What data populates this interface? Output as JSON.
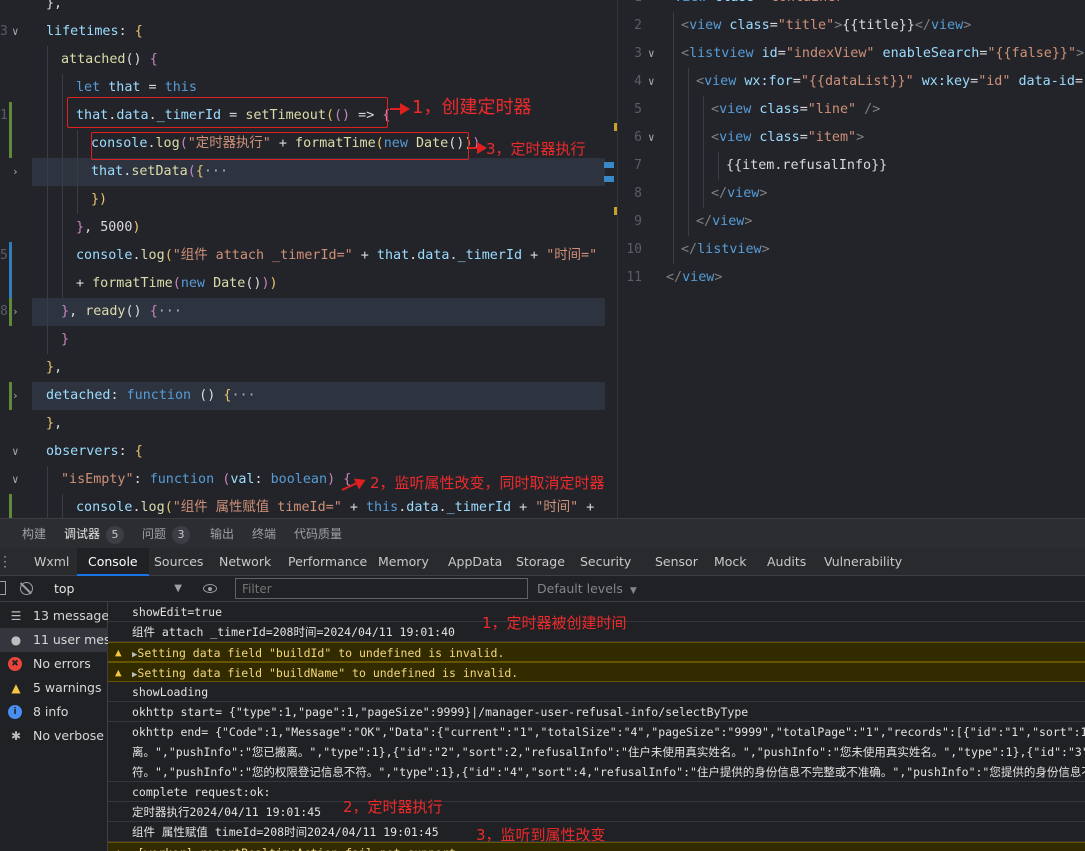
{
  "editor_left": {
    "lines": [
      {
        "num": "",
        "segs": [
          [
            "p",
            "},"
          ]
        ]
      },
      {
        "num": "3",
        "segs": [
          [
            "pr",
            "lifetimes"
          ],
          [
            "o",
            ": "
          ],
          [
            "y",
            "{"
          ]
        ]
      },
      {
        "num": "",
        "segs": [
          [
            "fn",
            "attached"
          ],
          [
            "p",
            "() "
          ],
          [
            "pk",
            "{"
          ]
        ]
      },
      {
        "num": "",
        "segs": [
          [
            "k",
            "let "
          ],
          [
            "pr",
            "that"
          ],
          [
            "o",
            " = "
          ],
          [
            "k",
            "this"
          ]
        ]
      },
      {
        "num": "1",
        "segs": [
          [
            "pr",
            "that"
          ],
          [
            "o",
            "."
          ],
          [
            "pr",
            "data"
          ],
          [
            "o",
            "."
          ],
          [
            "pr",
            "_timerId"
          ],
          [
            "o",
            " = "
          ],
          [
            "fn",
            "setTimeout"
          ],
          [
            "y",
            "("
          ],
          [
            "pk",
            "()"
          ],
          [
            "o",
            " => "
          ],
          [
            "pk",
            "{"
          ]
        ]
      },
      {
        "num": "",
        "segs": [
          [
            "pr",
            "console"
          ],
          [
            "o",
            "."
          ],
          [
            "fn",
            "log"
          ],
          [
            "pk",
            "("
          ],
          [
            "s",
            "\"定时器执行\""
          ],
          [
            "o",
            " + "
          ],
          [
            "fn",
            "formatTime"
          ],
          [
            "y",
            "("
          ],
          [
            "k",
            "new "
          ],
          [
            "fn",
            "Date"
          ],
          [
            "p",
            "()"
          ],
          [
            "y",
            ")"
          ],
          [
            "pk",
            ")"
          ]
        ]
      },
      {
        "num": "",
        "segs": [
          [
            "pr",
            "that"
          ],
          [
            "o",
            "."
          ],
          [
            "fn",
            "setData"
          ],
          [
            "pk",
            "("
          ],
          [
            "y",
            "{"
          ],
          [
            "g",
            "···"
          ]
        ]
      },
      {
        "num": "",
        "segs": [
          [
            "y",
            "})"
          ]
        ]
      },
      {
        "num": "",
        "segs": [
          [
            "pk",
            "}"
          ],
          [
            "o",
            ", "
          ],
          [
            "p",
            "5000"
          ],
          [
            "y",
            ")"
          ]
        ]
      },
      {
        "num": "5",
        "segs": [
          [
            "pr",
            "console"
          ],
          [
            "o",
            "."
          ],
          [
            "fn",
            "log"
          ],
          [
            "y",
            "("
          ],
          [
            "s",
            "\"组件 attach _timerId=\""
          ],
          [
            "o",
            " + "
          ],
          [
            "pr",
            "that"
          ],
          [
            "o",
            "."
          ],
          [
            "pr",
            "data"
          ],
          [
            "o",
            "."
          ],
          [
            "pr",
            "_timerId"
          ],
          [
            "o",
            " + "
          ],
          [
            "s",
            "\"时间=\""
          ]
        ]
      },
      {
        "num": "",
        "segs": [
          [
            "o",
            "+ "
          ],
          [
            "fn",
            "formatTime"
          ],
          [
            "pk",
            "("
          ],
          [
            "k",
            "new "
          ],
          [
            "fn",
            "Date"
          ],
          [
            "p",
            "()"
          ],
          [
            "pk",
            ")"
          ],
          [
            "y",
            ")"
          ]
        ]
      },
      {
        "num": "8",
        "segs": [
          [
            "pk",
            "}"
          ],
          [
            "o",
            ", "
          ],
          [
            "fn",
            "ready"
          ],
          [
            "p",
            "() "
          ],
          [
            "pk",
            "{"
          ],
          [
            "g",
            "···"
          ]
        ]
      },
      {
        "num": "",
        "segs": [
          [
            "pk",
            "}"
          ]
        ]
      },
      {
        "num": "",
        "segs": [
          [
            "y",
            "}"
          ],
          [
            "o",
            ","
          ]
        ]
      },
      {
        "num": "",
        "segs": [
          [
            "pr",
            "detached"
          ],
          [
            "o",
            ": "
          ],
          [
            "k",
            "function"
          ],
          [
            "p",
            " () "
          ],
          [
            "y",
            "{"
          ],
          [
            "g",
            "···"
          ]
        ]
      },
      {
        "num": "",
        "segs": [
          [
            "y",
            "}"
          ],
          [
            "o",
            ","
          ]
        ]
      },
      {
        "num": "",
        "segs": [
          [
            "pr",
            "observers"
          ],
          [
            "o",
            ": "
          ],
          [
            "y",
            "{"
          ]
        ]
      },
      {
        "num": "",
        "segs": [
          [
            "s",
            "\"isEmpty\""
          ],
          [
            "o",
            ": "
          ],
          [
            "k",
            "function "
          ],
          [
            "pk",
            "("
          ],
          [
            "pr",
            "val"
          ],
          [
            "o",
            ": "
          ],
          [
            "k",
            "boolean"
          ],
          [
            "pk",
            ")"
          ],
          [
            "o",
            " "
          ],
          [
            "pk",
            "{"
          ]
        ]
      },
      {
        "num": "",
        "segs": [
          [
            "pr",
            "console"
          ],
          [
            "o",
            "."
          ],
          [
            "fn",
            "log"
          ],
          [
            "y",
            "("
          ],
          [
            "s",
            "\"组件 属性赋值 timeId=\""
          ],
          [
            "o",
            " + "
          ],
          [
            "k",
            "this"
          ],
          [
            "o",
            "."
          ],
          [
            "pr",
            "data"
          ],
          [
            "o",
            "."
          ],
          [
            "pr",
            "_timerId"
          ],
          [
            "o",
            " + "
          ],
          [
            "s",
            "\"时间\""
          ],
          [
            "o",
            " +"
          ]
        ]
      }
    ]
  },
  "editor_right": {
    "lines": [
      {
        "num": "1",
        "segs": [
          [
            "br",
            "<"
          ],
          [
            "tag",
            "view "
          ],
          [
            "at",
            "class"
          ],
          [
            "o",
            "="
          ],
          [
            "av",
            "\"container\""
          ],
          [
            "br",
            ">"
          ]
        ]
      },
      {
        "num": "2",
        "segs": [
          [
            "br",
            "<"
          ],
          [
            "tag",
            "view "
          ],
          [
            "at",
            "class"
          ],
          [
            "o",
            "="
          ],
          [
            "av",
            "\"title\""
          ],
          [
            "br",
            ">"
          ],
          [
            "p",
            "{{title}}"
          ],
          [
            "br",
            "</"
          ],
          [
            "tag",
            "view"
          ],
          [
            "br",
            ">"
          ]
        ]
      },
      {
        "num": "3",
        "segs": [
          [
            "br",
            "<"
          ],
          [
            "tag",
            "listview "
          ],
          [
            "at",
            "id"
          ],
          [
            "o",
            "="
          ],
          [
            "av",
            "\"indexView\""
          ],
          [
            "at",
            " enableSearch"
          ],
          [
            "o",
            "="
          ],
          [
            "av",
            "\"{{false}}\""
          ],
          [
            "br",
            ">"
          ]
        ]
      },
      {
        "num": "4",
        "segs": [
          [
            "br",
            "<"
          ],
          [
            "tag",
            "view "
          ],
          [
            "at",
            "wx:for"
          ],
          [
            "o",
            "="
          ],
          [
            "av",
            "\"{{dataList}}\""
          ],
          [
            "at",
            " wx:key"
          ],
          [
            "o",
            "="
          ],
          [
            "av",
            "\"id\""
          ],
          [
            "at",
            " data-id"
          ],
          [
            "o",
            "="
          ],
          [
            "av",
            "\"{{"
          ]
        ]
      },
      {
        "num": "5",
        "segs": [
          [
            "br",
            "<"
          ],
          [
            "tag",
            "view "
          ],
          [
            "at",
            "class"
          ],
          [
            "o",
            "="
          ],
          [
            "av",
            "\"line\""
          ],
          [
            "br",
            " />"
          ]
        ]
      },
      {
        "num": "6",
        "segs": [
          [
            "br",
            "<"
          ],
          [
            "tag",
            "view "
          ],
          [
            "at",
            "class"
          ],
          [
            "o",
            "="
          ],
          [
            "av",
            "\"item\""
          ],
          [
            "br",
            ">"
          ]
        ]
      },
      {
        "num": "7",
        "segs": [
          [
            "p",
            "{{item.refusalInfo}}"
          ]
        ]
      },
      {
        "num": "8",
        "segs": [
          [
            "br",
            "</"
          ],
          [
            "tag",
            "view"
          ],
          [
            "br",
            ">"
          ]
        ]
      },
      {
        "num": "9",
        "segs": [
          [
            "br",
            "</"
          ],
          [
            "tag",
            "view"
          ],
          [
            "br",
            ">"
          ]
        ]
      },
      {
        "num": "10",
        "segs": [
          [
            "br",
            "</"
          ],
          [
            "tag",
            "listview"
          ],
          [
            "br",
            ">"
          ]
        ]
      },
      {
        "num": "11",
        "segs": [
          [
            "br",
            "</"
          ],
          [
            "tag",
            "view"
          ],
          [
            "br",
            ">"
          ]
        ]
      }
    ]
  },
  "annotations": {
    "a1": "1，创建定时器",
    "a3": "3，定时器执行",
    "a2": "2，监听属性改变，同时取消定时器",
    "log1": "1，定时器被创建时间",
    "log2": "2，定时器执行",
    "log3": "3，监听到属性改变"
  },
  "bottom_tabs": [
    {
      "label": "构建",
      "badge": ""
    },
    {
      "label": "调试器",
      "badge": "5"
    },
    {
      "label": "问题",
      "badge": "3"
    },
    {
      "label": "输出",
      "badge": ""
    },
    {
      "label": "终端",
      "badge": ""
    },
    {
      "label": "代码质量",
      "badge": ""
    }
  ],
  "devtools_tabs": [
    "Wxml",
    "Console",
    "Sources",
    "Network",
    "Performance",
    "Memory",
    "AppData",
    "Storage",
    "Security",
    "Sensor",
    "Mock",
    "Audits",
    "Vulnerability"
  ],
  "toolbar": {
    "context": "top",
    "filter_placeholder": "Filter",
    "levels": "Default levels"
  },
  "sidebar": [
    {
      "icon": "list-icon",
      "glyph": "☰",
      "label": "13 messages",
      "color": "#bdbdbd"
    },
    {
      "icon": "user-icon",
      "glyph": "●",
      "label": "11 user mes...",
      "color": "#bdbdbd"
    },
    {
      "icon": "error-icon",
      "glyph": "✖",
      "label": "No errors",
      "color": "#e8453c"
    },
    {
      "icon": "warning-icon",
      "glyph": "▲",
      "label": "5 warnings",
      "color": "#f6c445"
    },
    {
      "icon": "info-icon",
      "glyph": "i",
      "label": "8 info",
      "color": "#4a8ef0"
    },
    {
      "icon": "verbose-icon",
      "glyph": "✱",
      "label": "No verbose",
      "color": "#bdbdbd"
    }
  ],
  "console_log": [
    {
      "type": "log",
      "text": "showEdit=true"
    },
    {
      "type": "log",
      "text": "组件 attach _timerId=208时间=2024/04/11 19:01:40"
    },
    {
      "type": "warn",
      "text": "Setting data field \"buildId\" to undefined is invalid."
    },
    {
      "type": "warn",
      "text": "Setting data field \"buildName\" to undefined is invalid."
    },
    {
      "type": "log",
      "text": "showLoading"
    },
    {
      "type": "log",
      "text": "okhttp start= {\"type\":1,\"page\":1,\"pageSize\":9999}|/manager-user-refusal-info/selectByType"
    },
    {
      "type": "log",
      "text": "okhttp end= {\"Code\":1,\"Message\":\"OK\",\"Data\":{\"current\":\"1\",\"totalSize\":\"4\",\"pageSize\":\"9999\",\"totalPage\":\"1\",\"records\":[{\"id\":\"1\",\"sort\":1,\"refus\n离。\",\"pushInfo\":\"您已搬离。\",\"type\":1},{\"id\":\"2\",\"sort\":2,\"refusalInfo\":\"住户未使用真实姓名。\",\"pushInfo\":\"您未使用真实姓名。\",\"type\":1},{\"id\":\"3\",\"\n符。\",\"pushInfo\":\"您的权限登记信息不符。\",\"type\":1},{\"id\":\"4\",\"sort\":4,\"refusalInfo\":\"住户提供的身份信息不完整或不准确。\",\"pushInfo\":\"您提供的身份信息不"
    },
    {
      "type": "log",
      "text": "complete request:ok:"
    },
    {
      "type": "log",
      "text": "定时器执行2024/04/11 19:01:45"
    },
    {
      "type": "log",
      "text": "组件 属性赋值 timeId=208时间2024/04/11 19:01:45"
    },
    {
      "type": "warn",
      "text": "[worker] reportRealtimeAction:fail not support"
    }
  ]
}
